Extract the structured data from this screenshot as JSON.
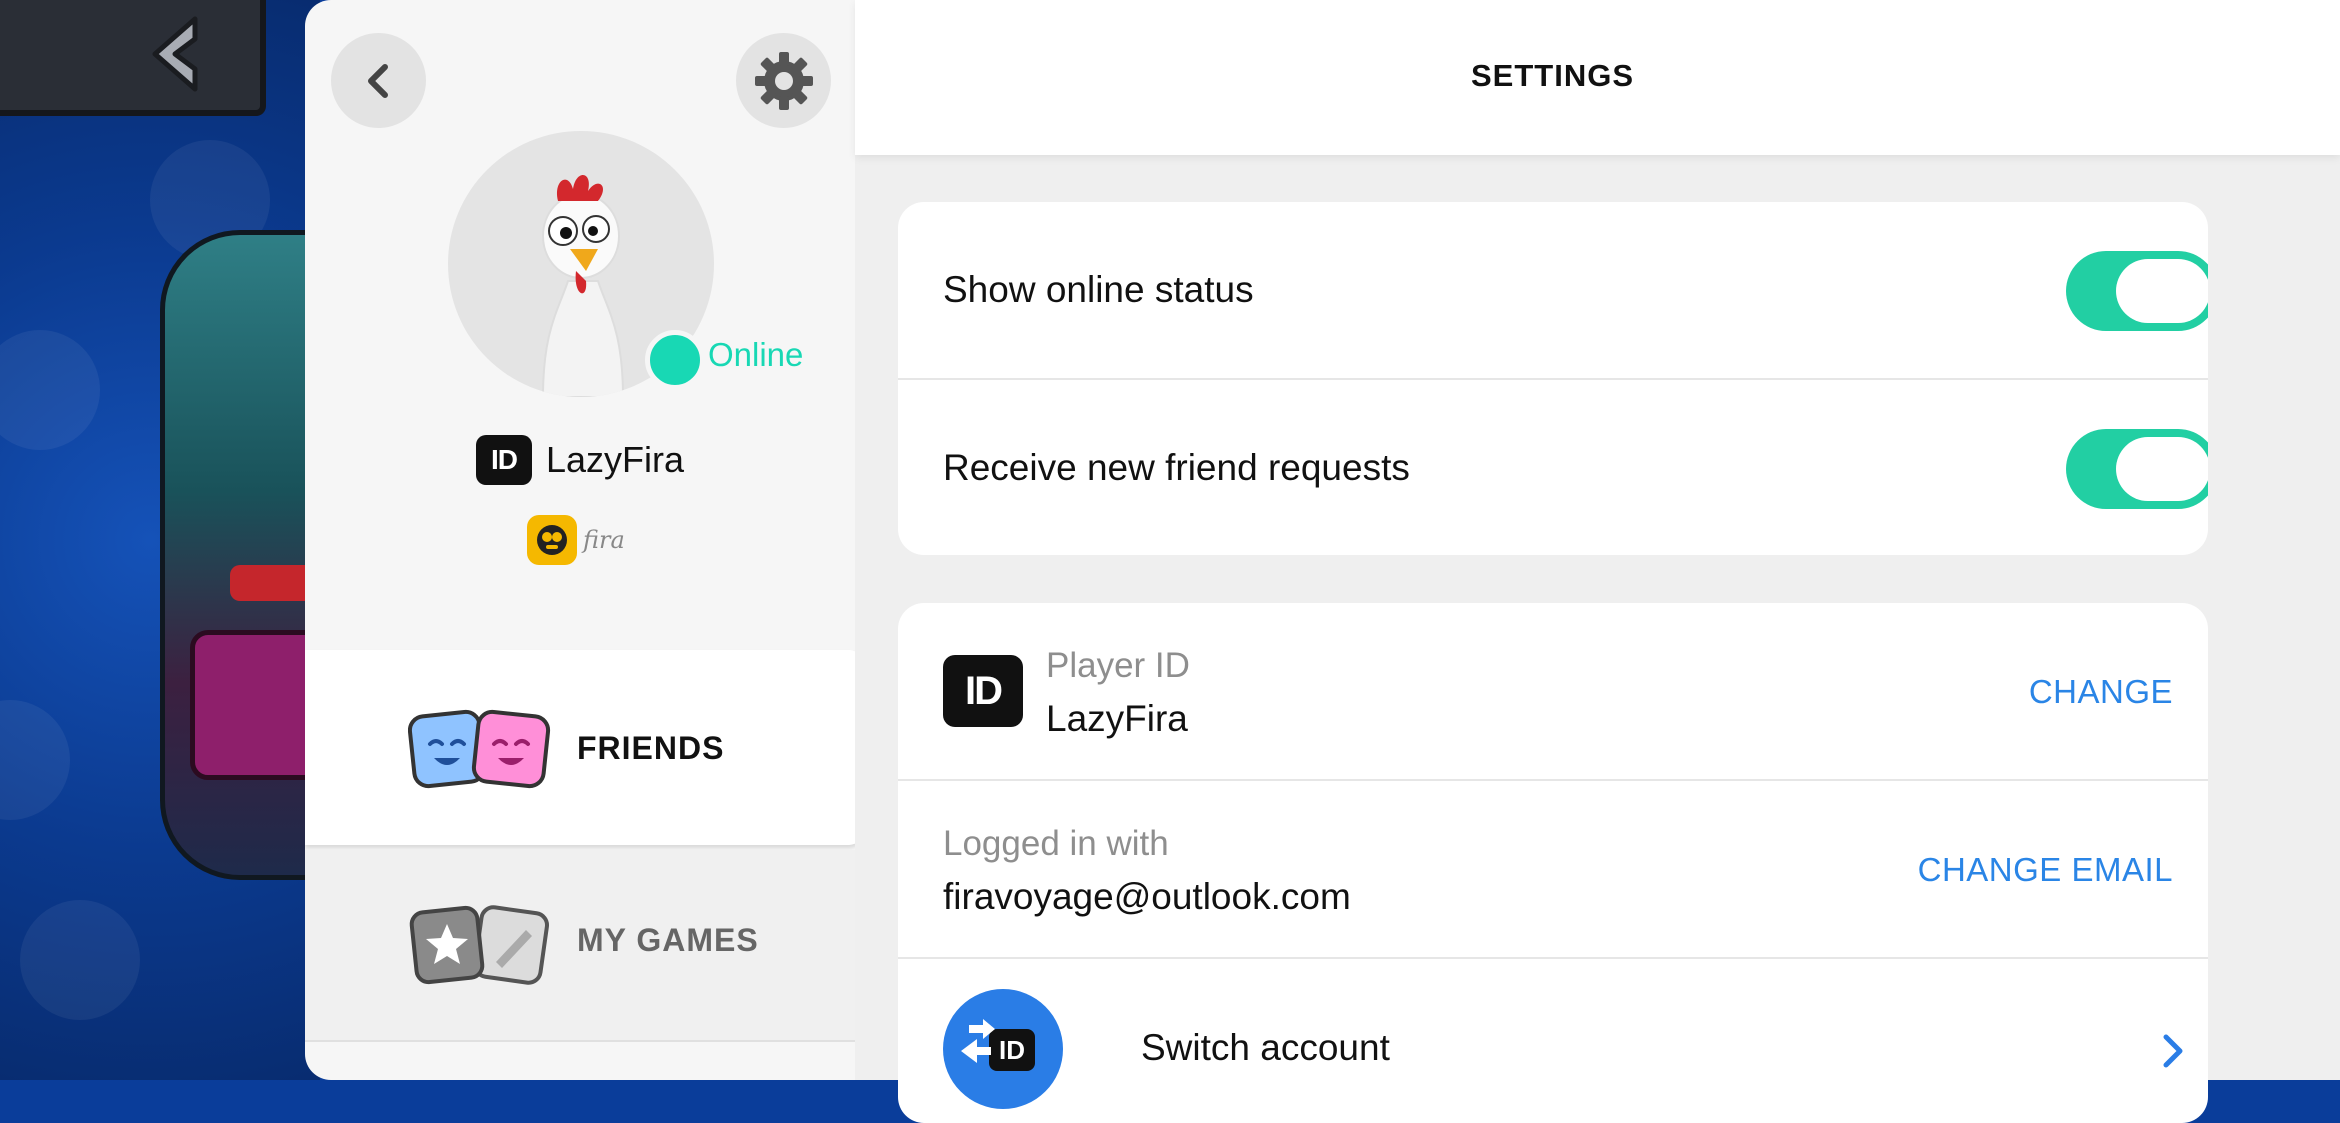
{
  "profile": {
    "status": "Online",
    "id_badge": "ID",
    "name": "LazyFira",
    "club_signature": "fira"
  },
  "nav": {
    "friends_label": "FRIENDS",
    "games_label": "MY GAMES"
  },
  "settings": {
    "title": "SETTINGS",
    "toggles": [
      {
        "label": "Show online status",
        "on": true
      },
      {
        "label": "Receive new friend requests",
        "on": true
      }
    ],
    "player_id": {
      "badge": "ID",
      "label": "Player ID",
      "value": "LazyFira",
      "action": "CHANGE"
    },
    "login": {
      "label": "Logged in with",
      "value": "firavoyage@outlook.com",
      "action": "CHANGE EMAIL"
    },
    "switch_account": {
      "badge": "ID",
      "label": "Switch account"
    }
  },
  "colors": {
    "accent_green": "#22cfa3",
    "online_green": "#18d8b4",
    "link_blue": "#2a85e6",
    "switch_blue": "#2a7de6"
  },
  "icons": [
    "back-arrow-icon",
    "gear-icon",
    "chevron-left-icon",
    "chevron-right-icon",
    "id-icon",
    "friends-icon",
    "games-icon",
    "club-icon",
    "switch-account-icon"
  ]
}
